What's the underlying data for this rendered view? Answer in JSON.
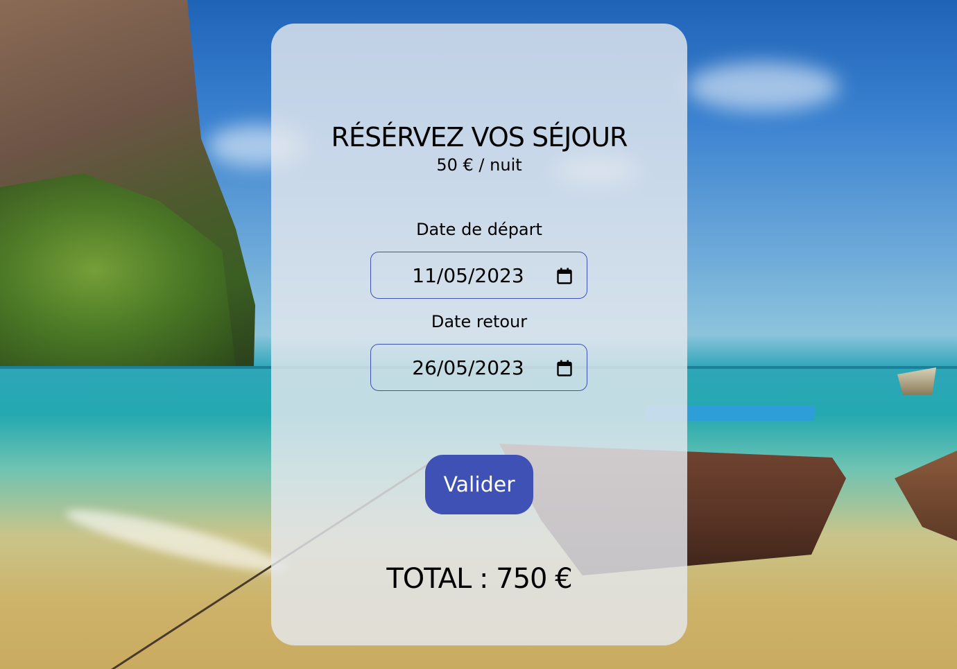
{
  "booking": {
    "title": "RÉSÉRVEZ VOS SÉJOUR",
    "price": "50 € / nuit",
    "departure": {
      "label": "Date de départ",
      "value": "11/05/2023"
    },
    "return": {
      "label": "Date retour",
      "value": "26/05/2023"
    },
    "submit_label": "Valider",
    "total": "TOTAL : 750 €"
  },
  "icons": {
    "calendar": "calendar-icon"
  },
  "colors": {
    "accent": "#3f51b5",
    "card": "#e4e8ee",
    "text": "#000000"
  }
}
